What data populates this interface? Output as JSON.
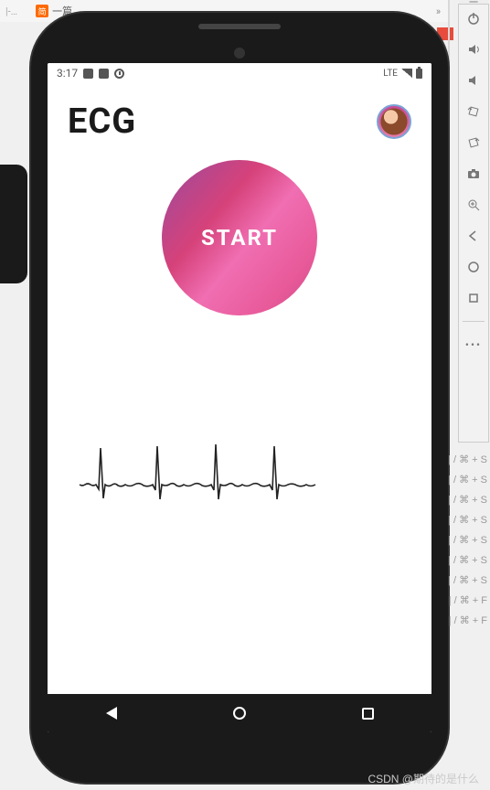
{
  "browser": {
    "tab_label": "一篇…",
    "arrow": "»"
  },
  "status": {
    "time": "3:17",
    "network": "LTE"
  },
  "app": {
    "title": "ECG",
    "start_label": "START"
  },
  "emulator_tools": [
    "power",
    "volume-up",
    "volume-down",
    "rotate-left",
    "rotate-right",
    "camera",
    "zoom-in",
    "back",
    "home",
    "overview",
    "more"
  ],
  "shortcuts": [
    "⌘ + S",
    "⌘ + S",
    "⌘ + S",
    "⌘ + S",
    "⌘ + S",
    "⌘ + S",
    "⌘ + S",
    "⌘ + F",
    "⌘ + F"
  ],
  "shortcut_prefix": "| / ",
  "watermark": "CSDN @期待的是什么"
}
